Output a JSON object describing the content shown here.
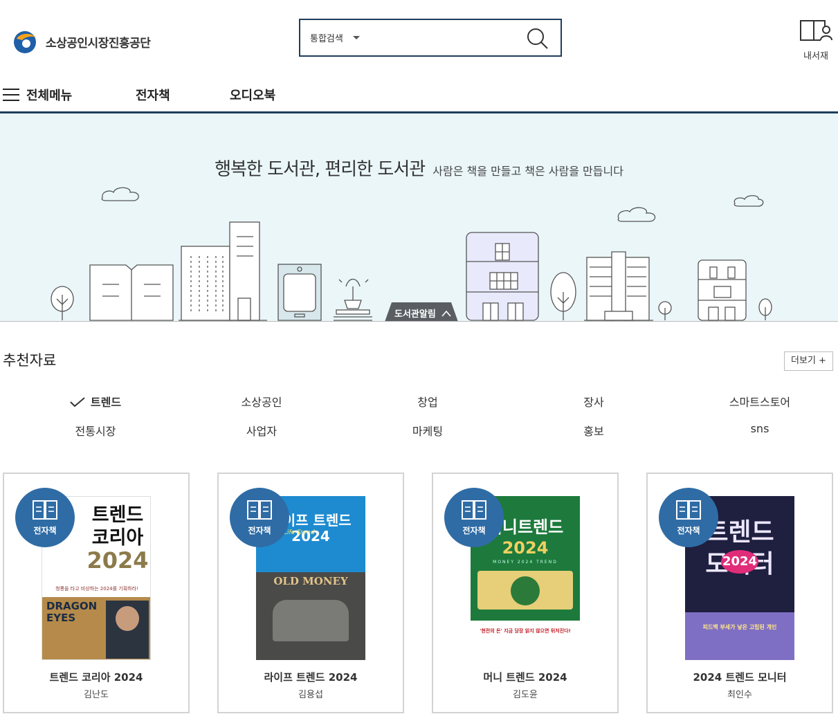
{
  "header": {
    "logo_text": "소상공인시장진흥공단",
    "search_type": "통합검색",
    "search_placeholder": "",
    "my_library": "내서재"
  },
  "gnb": {
    "all_menu": "전체메뉴",
    "items": [
      "전자책",
      "오디오북"
    ]
  },
  "hero": {
    "title": "행복한 도서관, 편리한 도서관",
    "subtitle": "사람은 책을 만들고 책은 사람을 만듭니다",
    "notice_tab": "도서관알림"
  },
  "recommend": {
    "title": "추천자료",
    "more": "더보기 +",
    "tabs": [
      "트렌드",
      "소상공인",
      "창업",
      "장사",
      "스마트스토어",
      "전통시장",
      "사업자",
      "마케팅",
      "홍보",
      "sns"
    ],
    "active_tab": "트렌드"
  },
  "books": [
    {
      "badge": "전자책",
      "title": "트렌드 코리아 2024",
      "author": "김난도"
    },
    {
      "badge": "전자책",
      "title": "라이프 트렌드 2024",
      "author": "김용섭"
    },
    {
      "badge": "전자책",
      "title": "머니 트렌드 2024",
      "author": "김도윤"
    },
    {
      "badge": "전자책",
      "title": "2024 트렌드 모니터",
      "author": "최인수"
    }
  ],
  "covers": [
    {
      "lines": [
        "트렌드",
        "코리아",
        "2024"
      ],
      "tagline": "청룡을 타고 비상하는 2024를 기획하라!",
      "bottom": "DRAGON EYES"
    },
    {
      "lines": [
        "라이프 트렌드",
        "2024"
      ],
      "accent": "Life Trend",
      "bottom": "OLD MONEY"
    },
    {
      "lines": [
        "머니트렌드",
        "2024"
      ],
      "accent": "MONEY 2024 TREND",
      "tagline": "'현전의 돈' 지금 당장 읽지 않으면 뒤처진다!"
    },
    {
      "lines": [
        "트렌드",
        "모니터",
        "2024"
      ],
      "tagline": "피드백 부세가 낳은 고립된 개인"
    }
  ],
  "colors": {
    "navy": "#1e3d5c",
    "badge_blue": "#2f6ca5",
    "hero_bg": "#eaf6f8"
  }
}
